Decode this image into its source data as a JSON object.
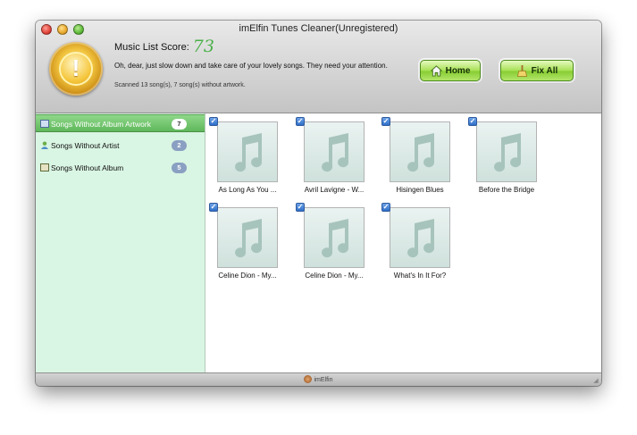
{
  "window": {
    "title": "imElfin Tunes Cleaner(Unregistered)"
  },
  "header": {
    "score_label": "Music List Score:",
    "score_value": "73",
    "message": "Oh, dear, just slow down and take care of your lovely songs. They need your attention.",
    "scanned": "Scanned 13 song(s), 7 song(s) without artwork.",
    "home_label": "Home",
    "fix_label": "Fix All"
  },
  "sidebar": {
    "items": [
      {
        "label": "Songs Without Album Artwork",
        "count": "7",
        "selected": true,
        "icon": "image-icon"
      },
      {
        "label": "Songs Without Artist",
        "count": "2",
        "selected": false,
        "icon": "person-icon"
      },
      {
        "label": "Songs Without Album",
        "count": "5",
        "selected": false,
        "icon": "album-icon"
      }
    ]
  },
  "songs": [
    {
      "label": "As Long As You ...",
      "checked": true
    },
    {
      "label": "Avril Lavigne - W...",
      "checked": true
    },
    {
      "label": "Hisingen Blues",
      "checked": true
    },
    {
      "label": "Before the Bridge",
      "checked": true
    },
    {
      "label": "Celine Dion - My...",
      "checked": true
    },
    {
      "label": "Celine Dion - My...",
      "checked": true
    },
    {
      "label": "What's In It For?",
      "checked": true
    }
  ],
  "footer": {
    "brand": "imElfin"
  },
  "colors": {
    "accent_green": "#4bb04a",
    "sidebar_bg": "#d9f5e3",
    "selected_item": "#5fb75a"
  }
}
